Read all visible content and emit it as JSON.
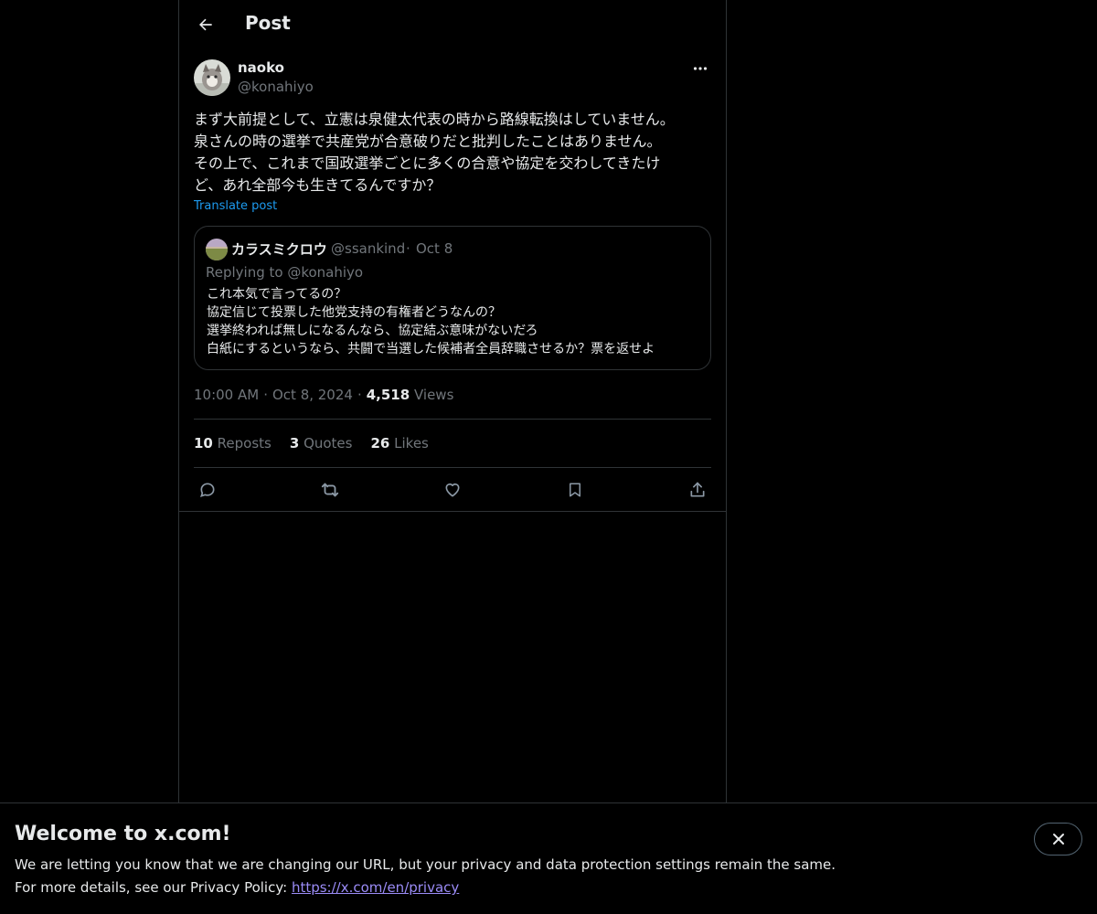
{
  "header": {
    "title": "Post",
    "back_icon": "arrow-left-icon"
  },
  "author": {
    "name": "naoko",
    "handle": "@konahiyo"
  },
  "post": {
    "lines": [
      "まず大前提として、立憲は泉健太代表の時から路線転換はしていません。",
      "泉さんの時の選挙で共産党が合意破りだと批判したことはありません。",
      "その上で、これまで国政選挙ごとに多くの合意や協定を交わしてきたけ",
      "ど、あれ全部今も生きてるんですか？"
    ],
    "translate_label": "Translate post"
  },
  "quote": {
    "name": "カラスミクロウ",
    "handle": "@ssankind",
    "dot": "·",
    "date": "Oct 8",
    "replying_to": "Replying to @konahiyo",
    "lines": [
      "これ本気で言ってるの？",
      "協定信じて投票した他党支持の有権者どうなんの？",
      "選挙終われば無しになるんなら、協定結ぶ意味がないだろ",
      "白紙にするというなら、共闘で当選した候補者全員辞職させるか？票を返せよ"
    ]
  },
  "meta": {
    "time": "10:00 AM",
    "date": "Oct 8, 2024",
    "views_count": "4,518",
    "views_label": "Views",
    "separator": "·"
  },
  "stats": {
    "reposts_count": "10",
    "reposts_label": "Reposts",
    "quotes_count": "3",
    "quotes_label": "Quotes",
    "likes_count": "26",
    "likes_label": "Likes"
  },
  "actions": [
    "reply-icon",
    "repost-icon",
    "like-icon",
    "bookmark-icon",
    "share-icon"
  ],
  "banner": {
    "title": "Welcome to x.com!",
    "line1": "We are letting you know that we are changing our URL, but your privacy and data protection settings remain the same.",
    "line2_prefix": "For more details, see our Privacy Policy: ",
    "link": "https://x.com/en/privacy"
  },
  "colors": {
    "background": "#000000",
    "text": "#e7e9ea",
    "muted": "#71767b",
    "accent": "#1d9bf0",
    "border": "#2f3336",
    "link": "#9b8cf7"
  }
}
